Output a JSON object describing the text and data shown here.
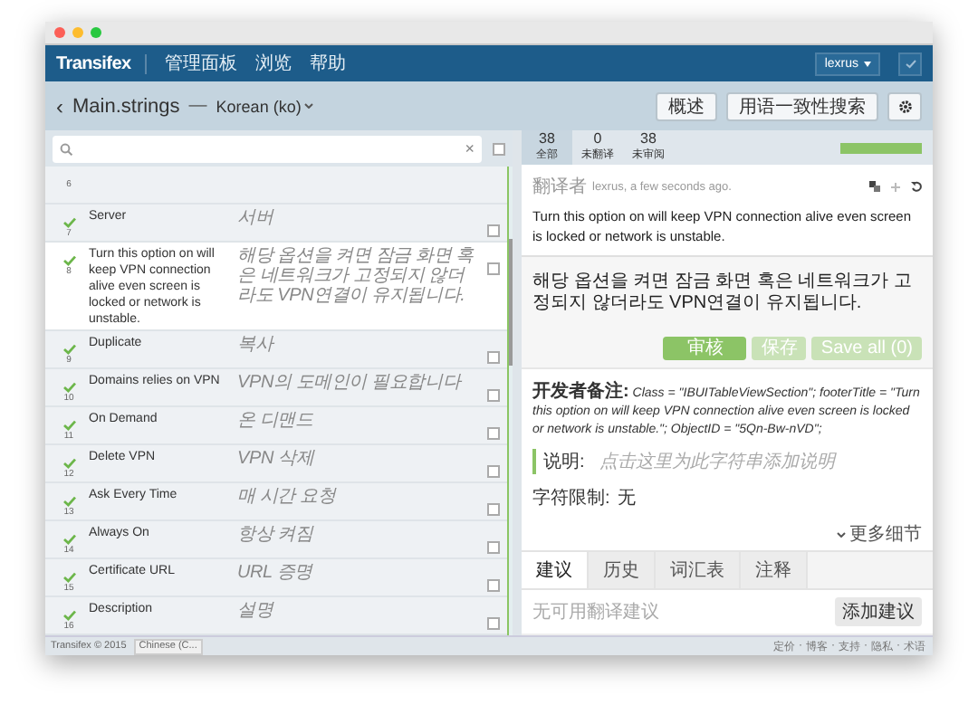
{
  "nav": {
    "logo": "Transifex",
    "items": [
      "管理面板",
      "浏览",
      "帮助"
    ],
    "user": "lexrus"
  },
  "header": {
    "back": "‹",
    "title": "Main.strings",
    "separator": "—",
    "language": "Korean (ko)",
    "buttons": [
      "概述",
      "用语一致性搜索"
    ]
  },
  "search": {
    "clear": "×",
    "select_all_checked": false
  },
  "rows": [
    {
      "number": "6",
      "selected": false
    },
    {
      "number": "7",
      "source": "Server",
      "translation": "서버",
      "reviewed": true,
      "selected": false,
      "checked": false
    },
    {
      "number": "8",
      "source": "Turn this option on will keep VPN connection alive even screen is locked or network is unstable.",
      "translation": "해당 옵션을 켜면 잠금 화면 혹은 네트워크가 고정되지 않더라도 VPN연결이 유지됩니다.",
      "reviewed": true,
      "selected": true,
      "checked": false
    },
    {
      "number": "9",
      "source": "Duplicate",
      "translation": "복사",
      "reviewed": true,
      "selected": false,
      "checked": false
    },
    {
      "number": "10",
      "source": "Domains relies on VPN",
      "translation": "VPN의 도메인이 필요합니다",
      "reviewed": true,
      "selected": false,
      "checked": false
    },
    {
      "number": "11",
      "source": "On Demand",
      "translation": "온 디맨드",
      "reviewed": true,
      "selected": false,
      "checked": false
    },
    {
      "number": "12",
      "source": "Delete VPN",
      "translation": "VPN 삭제",
      "reviewed": true,
      "selected": false,
      "checked": false
    },
    {
      "number": "13",
      "source": "Ask Every Time",
      "translation": "매 시간 요청",
      "reviewed": true,
      "selected": false,
      "checked": false
    },
    {
      "number": "14",
      "source": "Always On",
      "translation": "항상 켜짐",
      "reviewed": true,
      "selected": false,
      "checked": false
    },
    {
      "number": "15",
      "source": "Certificate URL",
      "translation": "URL 증명",
      "reviewed": true,
      "selected": false,
      "checked": false
    },
    {
      "number": "16",
      "source": "Description",
      "translation": "설명",
      "reviewed": true,
      "selected": false,
      "checked": false
    }
  ],
  "stats": [
    {
      "count": "38",
      "label": "全部",
      "selected": true
    },
    {
      "count": "0",
      "label": "未翻译",
      "selected": false
    },
    {
      "count": "38",
      "label": "未审阅",
      "selected": false
    }
  ],
  "progress": {
    "level": 1
  },
  "translator": {
    "label": "翻译者",
    "text": "lexrus, a few seconds ago."
  },
  "source_text": "Turn this option on will keep VPN connection alive even screen is locked or network is unstable.",
  "translation_text": "해당 옵션을 켜면 잠금 화면 혹은 네트워크가 고정되지 않더라도 VPN연결이 유지됩니다.",
  "actions": [
    {
      "label": "审核",
      "kind": "primary"
    },
    {
      "label": "保存",
      "kind": "disabled"
    },
    {
      "label": "Save all (0)",
      "kind": "disabled"
    }
  ],
  "dev_note": {
    "label": "开发者备注:",
    "text": "Class = \"IBUITableViewSection\"; footerTitle = \"Turn this option on will keep VPN connection alive even screen is locked or network is unstable.\"; ObjectID = \"5Qn-Bw-nVD\";"
  },
  "description": {
    "label": "说明:",
    "placeholder": "点击这里为此字符串添加说明"
  },
  "char_limit": {
    "label": "字符限制:",
    "value": "无"
  },
  "more": "更多细节",
  "bottom_tabs": [
    {
      "label": "建议",
      "selected": true
    },
    {
      "label": "历史",
      "selected": false
    },
    {
      "label": "词汇表",
      "selected": false
    },
    {
      "label": "注释",
      "selected": false
    }
  ],
  "suggestions": {
    "empty": "无可用翻译建议",
    "button": "添加建议"
  },
  "footer": {
    "copyright": "Transifex © 2015",
    "language": "Chinese (C...",
    "links": [
      "定价",
      "博客",
      "支持",
      "隐私",
      "术语"
    ],
    "separator": "·"
  }
}
